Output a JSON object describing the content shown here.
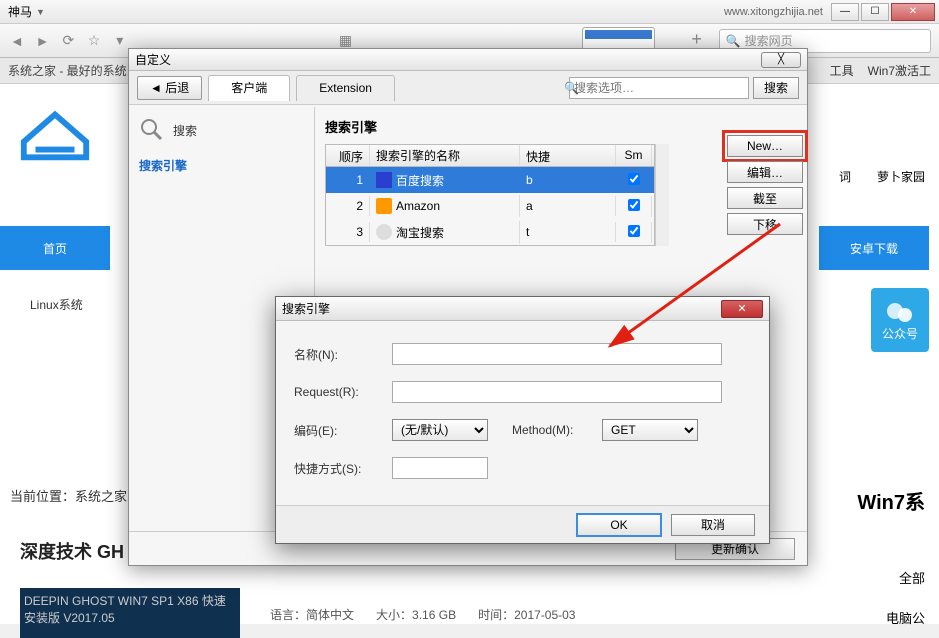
{
  "browser": {
    "title": "神马",
    "url": "www.xitongzhijia.net",
    "search_placeholder": "搜索网页"
  },
  "page": {
    "tab_title": "系统之家 - 最好的系统",
    "right_tabs": [
      "工具",
      "Win7激活工",
      "词",
      "萝卜家园"
    ],
    "nav_home": "首页",
    "nav_android": "安卓下载",
    "nav_linux": "Linux系统",
    "side_label": "公众号",
    "breadcrumb": "当前位置：系统之家",
    "article": "深度技术 GH",
    "win7": "Win7系",
    "r2": "全部",
    "r3": "电脑公",
    "thumb_text": "DEEPIN GHOST WIN7 SP1 X86 快速安装版 V2017.05",
    "meta_lang_label": "语言：",
    "meta_lang": "简体中文",
    "meta_size_label": "大小：",
    "meta_size": "3.16 GB",
    "meta_time_label": "时间：",
    "meta_time": "2017-05-03"
  },
  "dialog": {
    "title": "自定义",
    "back": "◄ 后退",
    "tab_client": "客户端",
    "tab_ext": "Extension",
    "search_placeholder": "搜索选项…",
    "search_btn": "搜索",
    "side_heading": "搜索",
    "side_link": "搜索引擎",
    "main_heading": "搜索引擎",
    "cols": {
      "seq": "顺序",
      "name": "搜索引擎的名称",
      "key": "快捷",
      "sm": "Sm"
    },
    "rows": [
      {
        "seq": "1",
        "name": "百度搜索",
        "key": "b",
        "sm": true,
        "icon": "baidu"
      },
      {
        "seq": "2",
        "name": "Amazon",
        "key": "a",
        "sm": true,
        "icon": "amazon"
      },
      {
        "seq": "3",
        "name": "淘宝搜索",
        "key": "t",
        "sm": true,
        "icon": "taobao"
      }
    ],
    "btn_new": "New…",
    "btn_edit": "编辑…",
    "btn_moveup": "截至",
    "btn_delete": "下移",
    "footer_btn": "更新确认"
  },
  "modal": {
    "title": "搜索引擎",
    "lbl_name": "名称(N):",
    "lbl_request": "Request(R):",
    "lbl_encoding": "编码(E):",
    "encoding_value": "(无/默认)",
    "lbl_method": "Method(M):",
    "method_value": "GET",
    "lbl_shortcut": "快捷方式(S):",
    "ok": "OK",
    "cancel": "取消"
  }
}
